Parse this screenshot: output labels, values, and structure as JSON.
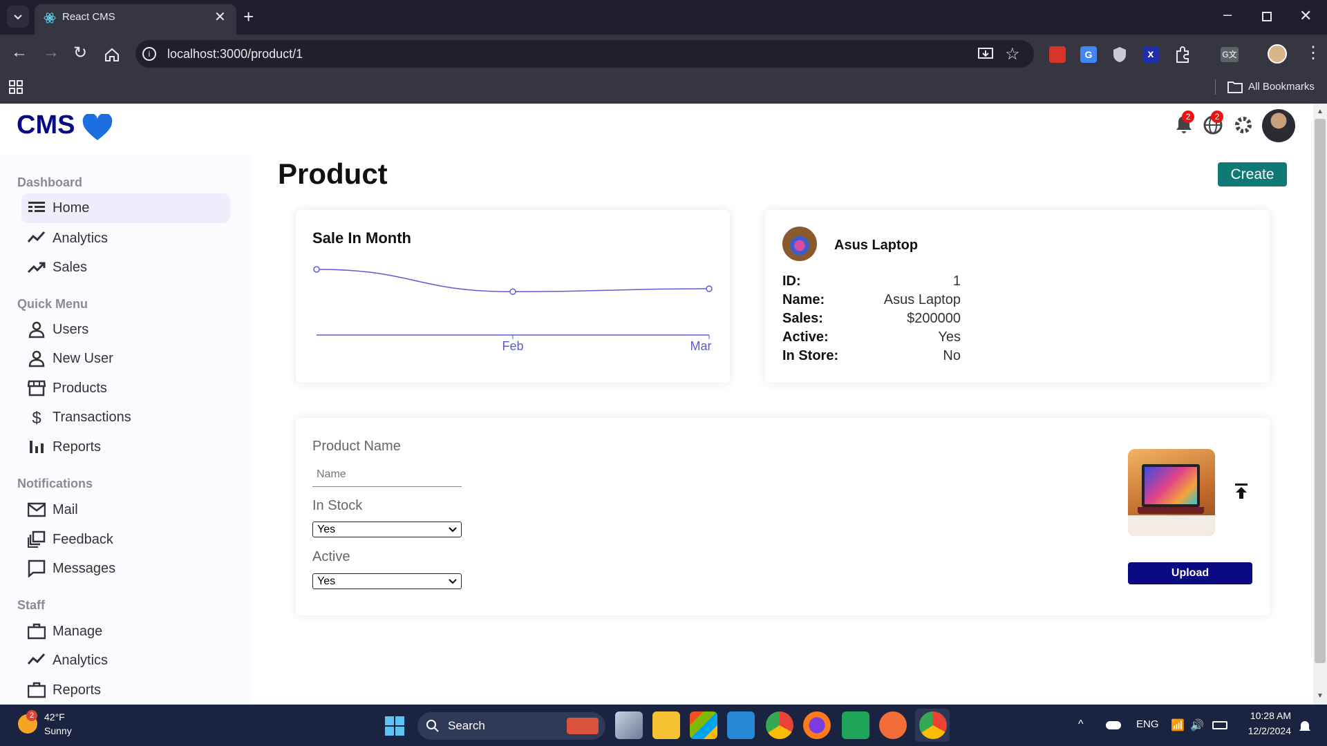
{
  "browser": {
    "tab_title": "React CMS",
    "url": "localhost:3000/product/1",
    "bookmarks_label": "All Bookmarks"
  },
  "app": {
    "logo": "CMS",
    "notif_count_bell": "2",
    "notif_count_globe": "2"
  },
  "sidebar": {
    "sections": [
      {
        "title": "Dashboard",
        "items": [
          {
            "label": "Home",
            "active": true
          },
          {
            "label": "Analytics"
          },
          {
            "label": "Sales"
          }
        ]
      },
      {
        "title": "Quick Menu",
        "items": [
          {
            "label": "Users"
          },
          {
            "label": "New User"
          },
          {
            "label": "Products"
          },
          {
            "label": "Transactions"
          },
          {
            "label": "Reports"
          }
        ]
      },
      {
        "title": "Notifications",
        "items": [
          {
            "label": "Mail"
          },
          {
            "label": "Feedback"
          },
          {
            "label": "Messages"
          }
        ]
      },
      {
        "title": "Staff",
        "items": [
          {
            "label": "Manage"
          },
          {
            "label": "Analytics"
          },
          {
            "label": "Reports"
          }
        ]
      }
    ]
  },
  "page": {
    "title": "Product",
    "create_label": "Create"
  },
  "chart_card": {
    "title": "Sale In Month"
  },
  "chart_data": {
    "type": "line",
    "title": "Sale In Month",
    "categories": [
      "",
      "Feb",
      "Mar"
    ],
    "series": [
      {
        "values": [
          100,
          62,
          67
        ]
      }
    ],
    "xlabel": "",
    "ylabel": "",
    "grid": false,
    "color": "#5b5bd6"
  },
  "product_info": {
    "name": "Asus Laptop",
    "rows": [
      {
        "key": "ID:",
        "value": "1"
      },
      {
        "key": "Name:",
        "value": "Asus Laptop"
      },
      {
        "key": "Sales:",
        "value": "$200000"
      },
      {
        "key": "Active:",
        "value": "Yes"
      },
      {
        "key": "In Store:",
        "value": "No"
      }
    ]
  },
  "form": {
    "product_name_label": "Product Name",
    "name_placeholder": "Name",
    "in_stock_label": "In Stock",
    "in_stock_value": "Yes",
    "active_label": "Active",
    "active_value": "Yes",
    "upload_label": "Upload"
  },
  "taskbar": {
    "weather_temp": "42°F",
    "weather_desc": "Sunny",
    "weather_badge": "2",
    "search_label": "Search",
    "lang": "ENG",
    "time": "10:28 AM",
    "date": "12/2/2024"
  },
  "colors": {
    "accent_teal": "#0f7a75",
    "upload_navy": "#0a0a82",
    "logo_navy": "#0a0a82",
    "chart_line": "#5b5bd6"
  }
}
